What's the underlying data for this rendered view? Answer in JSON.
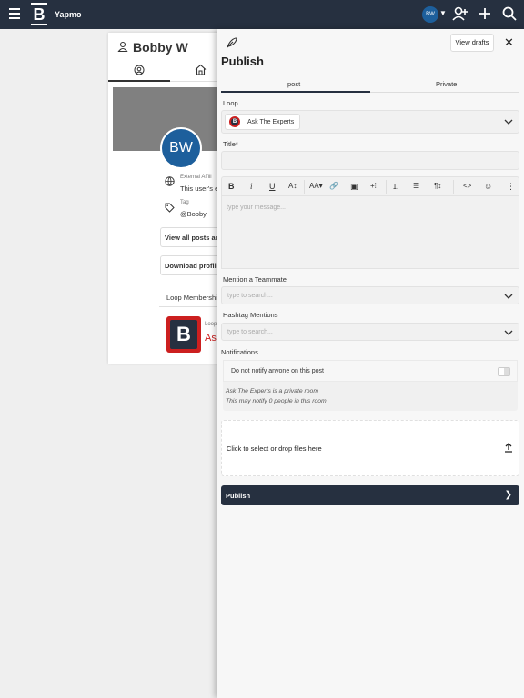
{
  "app": {
    "brand": "Yapmo",
    "user_initials": "BW",
    "caret": "▼"
  },
  "profile": {
    "name": "Bobby W",
    "avatar_initials": "BW",
    "external_affiliation_label": "External Affili",
    "external_affiliation_value": "This user's e",
    "tag_label": "Tag",
    "tag_value": "@Bobby",
    "view_all_posts": "View all posts an",
    "download_profile": "Download profile",
    "loop_memberships": "Loop Membershi",
    "loop_small_label": "Loop",
    "loop_name": "Ask",
    "loop_logo_letter": "B"
  },
  "publish": {
    "title": "Publish",
    "view_drafts": "View drafts",
    "close": "✕",
    "tabs": [
      "post",
      "Private"
    ],
    "loop_label": "Loop",
    "loop_value": "Ask The Experts",
    "loop_logo_letter": "B",
    "title_label": "Title*",
    "title_value": "",
    "toolbar": {
      "bold": "B",
      "italic": "i",
      "underline": "U",
      "text_size": "A↕",
      "font_case": "AA▾",
      "link": "🔗",
      "image": "▣",
      "insert": "+⁞",
      "ordered_list": "⒈",
      "bullet_list": "☰",
      "paragraph": "¶↕",
      "code": "<>",
      "emoji": "☺",
      "more": "⋮"
    },
    "message_placeholder": "type your message...",
    "mention_label": "Mention a Teammate",
    "mention_placeholder": "type to search...",
    "hashtag_label": "Hashtag Mentions",
    "hashtag_placeholder": "type to search...",
    "notifications_label": "Notifications",
    "notify_option": "Do not notify anyone on this post",
    "notify_toggle_on": false,
    "private_note": "Ask The Experts is a private room",
    "notify_count_note": "This may notify 0 people in this room",
    "drop_text": "Click to select or drop files here",
    "publish_button": "Publish",
    "publish_arrow": "❯"
  },
  "colors": {
    "navbar": "#263040",
    "accent_red": "#cc1f1f",
    "avatar_blue": "#1d5f9c"
  }
}
